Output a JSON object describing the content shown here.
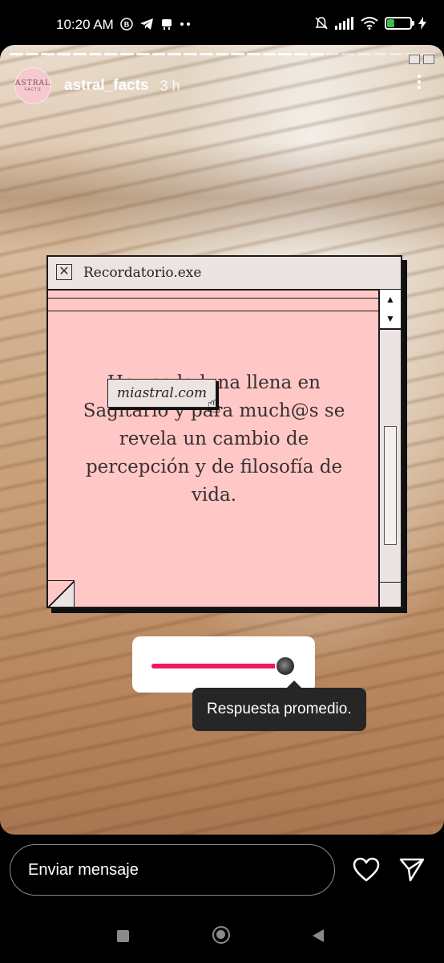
{
  "status_bar": {
    "time": "10:20 AM",
    "left_icons": [
      "b-badge-icon",
      "telegram-icon",
      "notification-icon",
      "more-dots-icon"
    ],
    "right_icons": [
      "mute-bell-icon",
      "signal-icon",
      "wifi-icon"
    ],
    "battery_level": "32",
    "battery_fraction": 0.32
  },
  "story": {
    "avatar_text_top": "ASTRAL",
    "avatar_text_bottom": "FACTS",
    "username": "astral_facts",
    "time_ago": "3 h",
    "progress_segments": 27,
    "progress_current": 20
  },
  "window": {
    "title": "Recordatorio.exe",
    "close_glyph": "✕",
    "message": "Hoy es la luna llena en Sagitario y para much@s se revela un cambio de percepción y de filosofía de vida.",
    "link_label": "miastral.com",
    "scroll_up_glyph": "▲",
    "scroll_down_glyph": "▼",
    "cursor_glyph": "☝"
  },
  "slider": {
    "value": 0.9,
    "accent_color": "#f0185f",
    "tooltip": "Respuesta promedio."
  },
  "bottom": {
    "message_placeholder": "Enviar mensaje"
  },
  "colors": {
    "window_pink": "#ffc8c7",
    "window_grey": "#ece4e3"
  }
}
